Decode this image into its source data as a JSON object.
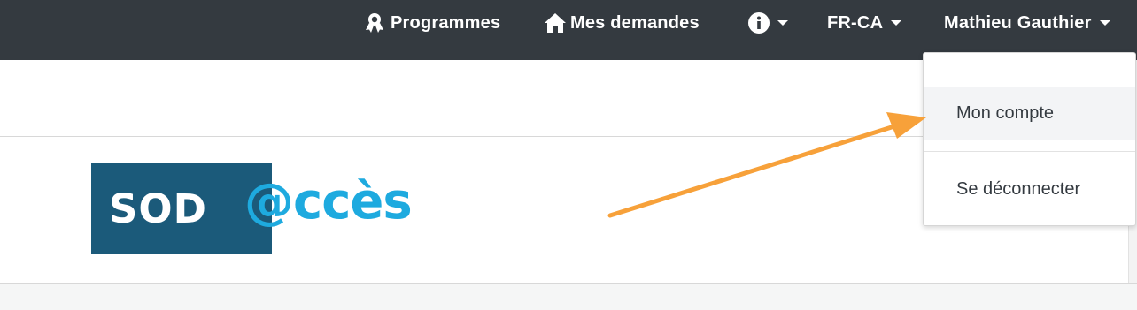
{
  "topbar": {
    "programs": {
      "label": "Programmes",
      "icon": "award-icon"
    },
    "requests": {
      "label": "Mes demandes",
      "icon": "home-icon"
    },
    "info": {
      "icon": "info-icon"
    },
    "language": {
      "label": "FR-CA"
    },
    "user": {
      "label": "Mathieu Gauthier"
    }
  },
  "logo": {
    "part1": "SOD",
    "part2": "@ccès"
  },
  "user_menu": {
    "items": [
      {
        "label": "Mon compte"
      },
      {
        "label": "Se déconnecter"
      }
    ]
  },
  "colors": {
    "topbar_bg": "#343a40",
    "logo_dark": "#1b5a7a",
    "logo_light": "#1eaadf",
    "annotation_arrow": "#f7a13a",
    "hover_bg": "#f3f4f6"
  }
}
